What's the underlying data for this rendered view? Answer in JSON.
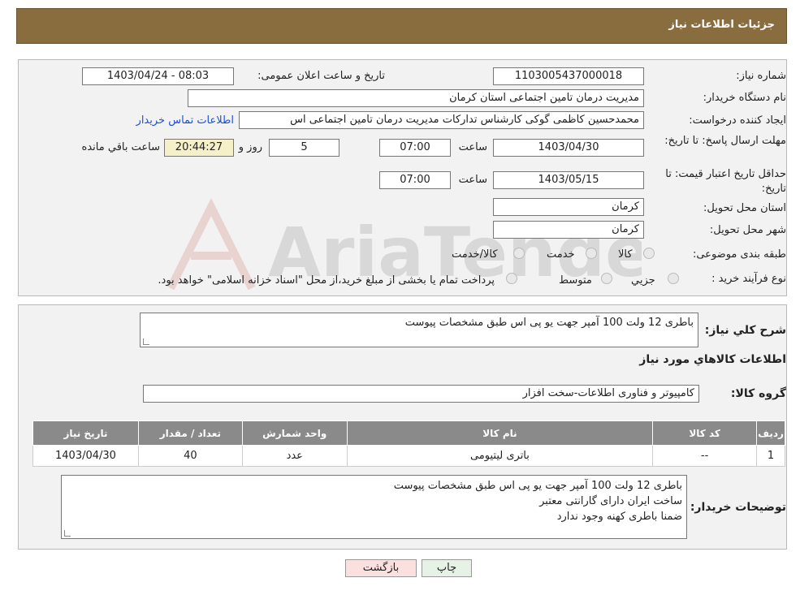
{
  "header": {
    "title": "جزئیات اطلاعات نیاز"
  },
  "form": {
    "need_number_label": "شماره نیاز:",
    "need_number": "1103005437000018",
    "announce_label": "تاریخ و ساعت اعلان عمومی:",
    "announce_value": "1403/04/24 - 08:03",
    "buyer_org_label": "نام دستگاه خریدار:",
    "buyer_org": "مدیریت درمان تامین اجتماعی استان کرمان",
    "creator_label": "ایجاد کننده درخواست:",
    "creator": "محمدحسین کاظمی گوکی کارشناس تدارکات مدیریت درمان تامین اجتماعی اس",
    "contact_link": "اطلاعات تماس خریدار",
    "deadline_label": "مهلت ارسال پاسخ: تا تاریخ:",
    "deadline_date": "1403/04/30",
    "hour_label": "ساعت",
    "deadline_time": "07:00",
    "days_value": "5",
    "day_and_label": "روز و",
    "remaining_time": "20:44:27",
    "remaining_label": "ساعت باقي مانده",
    "validity_label": "حداقل تاریخ اعتبار قیمت: تا تاریخ:",
    "validity_date": "1403/05/15",
    "validity_time": "07:00",
    "province_label": "استان محل تحویل:",
    "province": "کرمان",
    "city_label": "شهر محل تحویل:",
    "city": "کرمان",
    "category_label": "طبقه بندی موضوعی:",
    "category_options": [
      "کالا",
      "خدمت",
      "کالا/خدمت"
    ],
    "process_label": "نوع فرآیند خرید :",
    "process_options": [
      "جزیي",
      "متوسط"
    ],
    "process_note": "پرداخت تمام یا بخشی از مبلغ خرید،از محل \"اسناد خزانه اسلامی\" خواهد بود."
  },
  "details": {
    "summary_label": "شرح کلي نياز:",
    "summary": "باطری 12 ولت 100 آمپر جهت یو پی اس طبق مشخصات پیوست",
    "goods_info_title": "اطلاعات کالاهاي مورد نياز",
    "group_label": "گروه کالا:",
    "group": "کامپیوتر و فناوری اطلاعات-سخت افزار",
    "table_headers": [
      "رديف",
      "کد کالا",
      "نام کالا",
      "واحد شمارش",
      "تعداد / مقدار",
      "تاریخ نیاز"
    ],
    "table_rows": [
      [
        "1",
        "--",
        "باتری لیتیومی",
        "عدد",
        "40",
        "1403/04/30"
      ]
    ],
    "buyer_notes_label": "توضیحات خریدار:",
    "buyer_notes": [
      "باطری 12 ولت 100 آمپر جهت یو پی اس طبق مشخصات پیوست",
      "ساخت ایران دارای گارانتی معتبر",
      "ضمنا باطری کهنه وجود ندارد"
    ]
  },
  "buttons": {
    "print": "چاپ",
    "back": "بازگشت"
  },
  "watermark": {
    "text": "AriaTender.neT"
  }
}
